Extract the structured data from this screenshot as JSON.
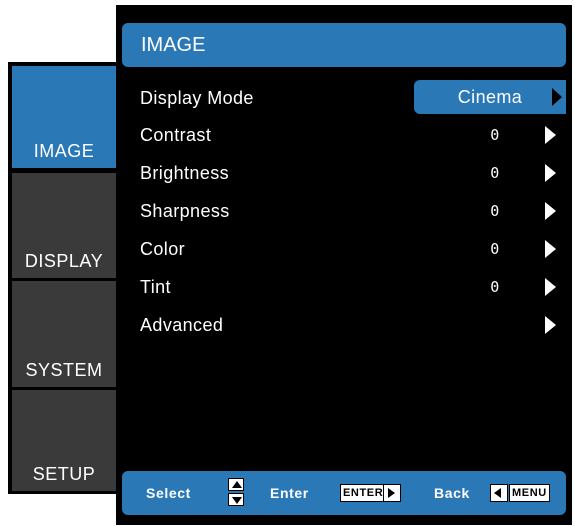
{
  "colors": {
    "accent": "#2a78b6",
    "background": "#000000",
    "tab_inactive": "#3a3a3a",
    "text": "#ffffff"
  },
  "tabs": [
    {
      "label": "IMAGE",
      "active": true
    },
    {
      "label": "DISPLAY",
      "active": false
    },
    {
      "label": "SYSTEM",
      "active": false
    },
    {
      "label": "SETUP",
      "active": false
    }
  ],
  "title": "IMAGE",
  "items": [
    {
      "label": "Display Mode",
      "value": "Cinema",
      "icon": "arrow-right-icon"
    },
    {
      "label": "Contrast",
      "value": "0",
      "icon": "arrow-right-icon"
    },
    {
      "label": "Brightness",
      "value": "0",
      "icon": "arrow-right-icon"
    },
    {
      "label": "Sharpness",
      "value": "0",
      "icon": "arrow-right-icon"
    },
    {
      "label": "Color",
      "value": "0",
      "icon": "arrow-right-icon"
    },
    {
      "label": "Tint",
      "value": "0",
      "icon": "arrow-right-icon"
    },
    {
      "label": "Advanced",
      "value": "",
      "icon": "arrow-right-icon"
    }
  ],
  "hints": {
    "select_label": "Select",
    "enter_label": "Enter",
    "enter_key": "ENTER",
    "back_label": "Back",
    "menu_key": "MENU"
  }
}
